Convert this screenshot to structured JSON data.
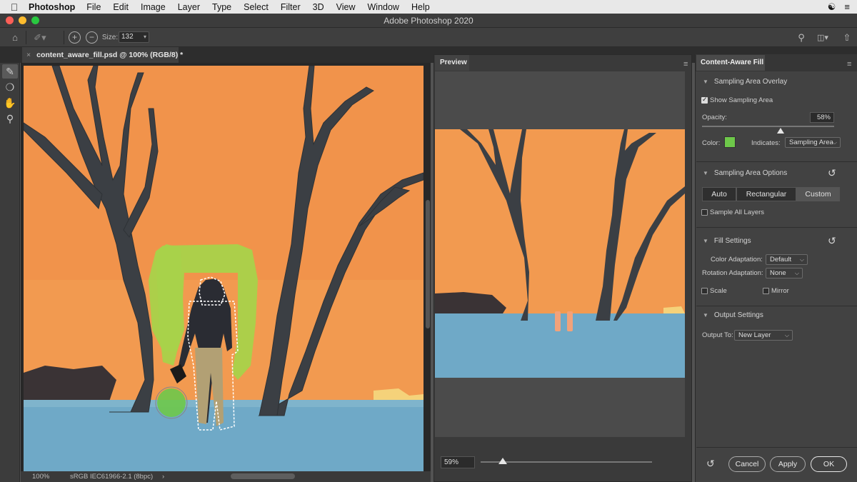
{
  "menubar": {
    "app_name": "Photoshop",
    "items": [
      "File",
      "Edit",
      "Image",
      "Layer",
      "Type",
      "Select",
      "Filter",
      "3D",
      "View",
      "Window",
      "Help"
    ]
  },
  "window": {
    "title": "Adobe Photoshop 2020"
  },
  "options_bar": {
    "size_label": "Size:",
    "size_value": "132"
  },
  "document": {
    "tab_title": "content_aware_fill.psd @ 100% (RGB/8) *",
    "zoom": "100%",
    "color_profile": "sRGB IEC61966-2.1 (8bpc)"
  },
  "preview": {
    "tab_title": "Preview",
    "zoom": "59%"
  },
  "panel": {
    "tab_title": "Content-Aware Fill",
    "sampling_overlay": {
      "title": "Sampling Area Overlay",
      "show_sampling_label": "Show Sampling Area",
      "show_sampling_checked": true,
      "opacity_label": "Opacity:",
      "opacity_value": "58%",
      "color_label": "Color:",
      "color_value": "#6ec84a",
      "indicates_label": "Indicates:",
      "indicates_value": "Sampling Area"
    },
    "sampling_options": {
      "title": "Sampling Area Options",
      "modes": [
        "Auto",
        "Rectangular",
        "Custom"
      ],
      "active_mode": "Custom",
      "sample_all_layers_label": "Sample All Layers"
    },
    "fill_settings": {
      "title": "Fill Settings",
      "color_adaptation_label": "Color Adaptation:",
      "color_adaptation_value": "Default",
      "rotation_adaptation_label": "Rotation Adaptation:",
      "rotation_adaptation_value": "None",
      "scale_label": "Scale",
      "mirror_label": "Mirror"
    },
    "output_settings": {
      "title": "Output Settings",
      "output_to_label": "Output To:",
      "output_to_value": "New Layer"
    },
    "buttons": {
      "cancel": "Cancel",
      "apply": "Apply",
      "ok": "OK"
    }
  },
  "colors": {
    "sky": "#f09a52",
    "ground": "#6fa9c7",
    "tree": "#3b3f44",
    "overlay_green": "#a8d24a"
  }
}
